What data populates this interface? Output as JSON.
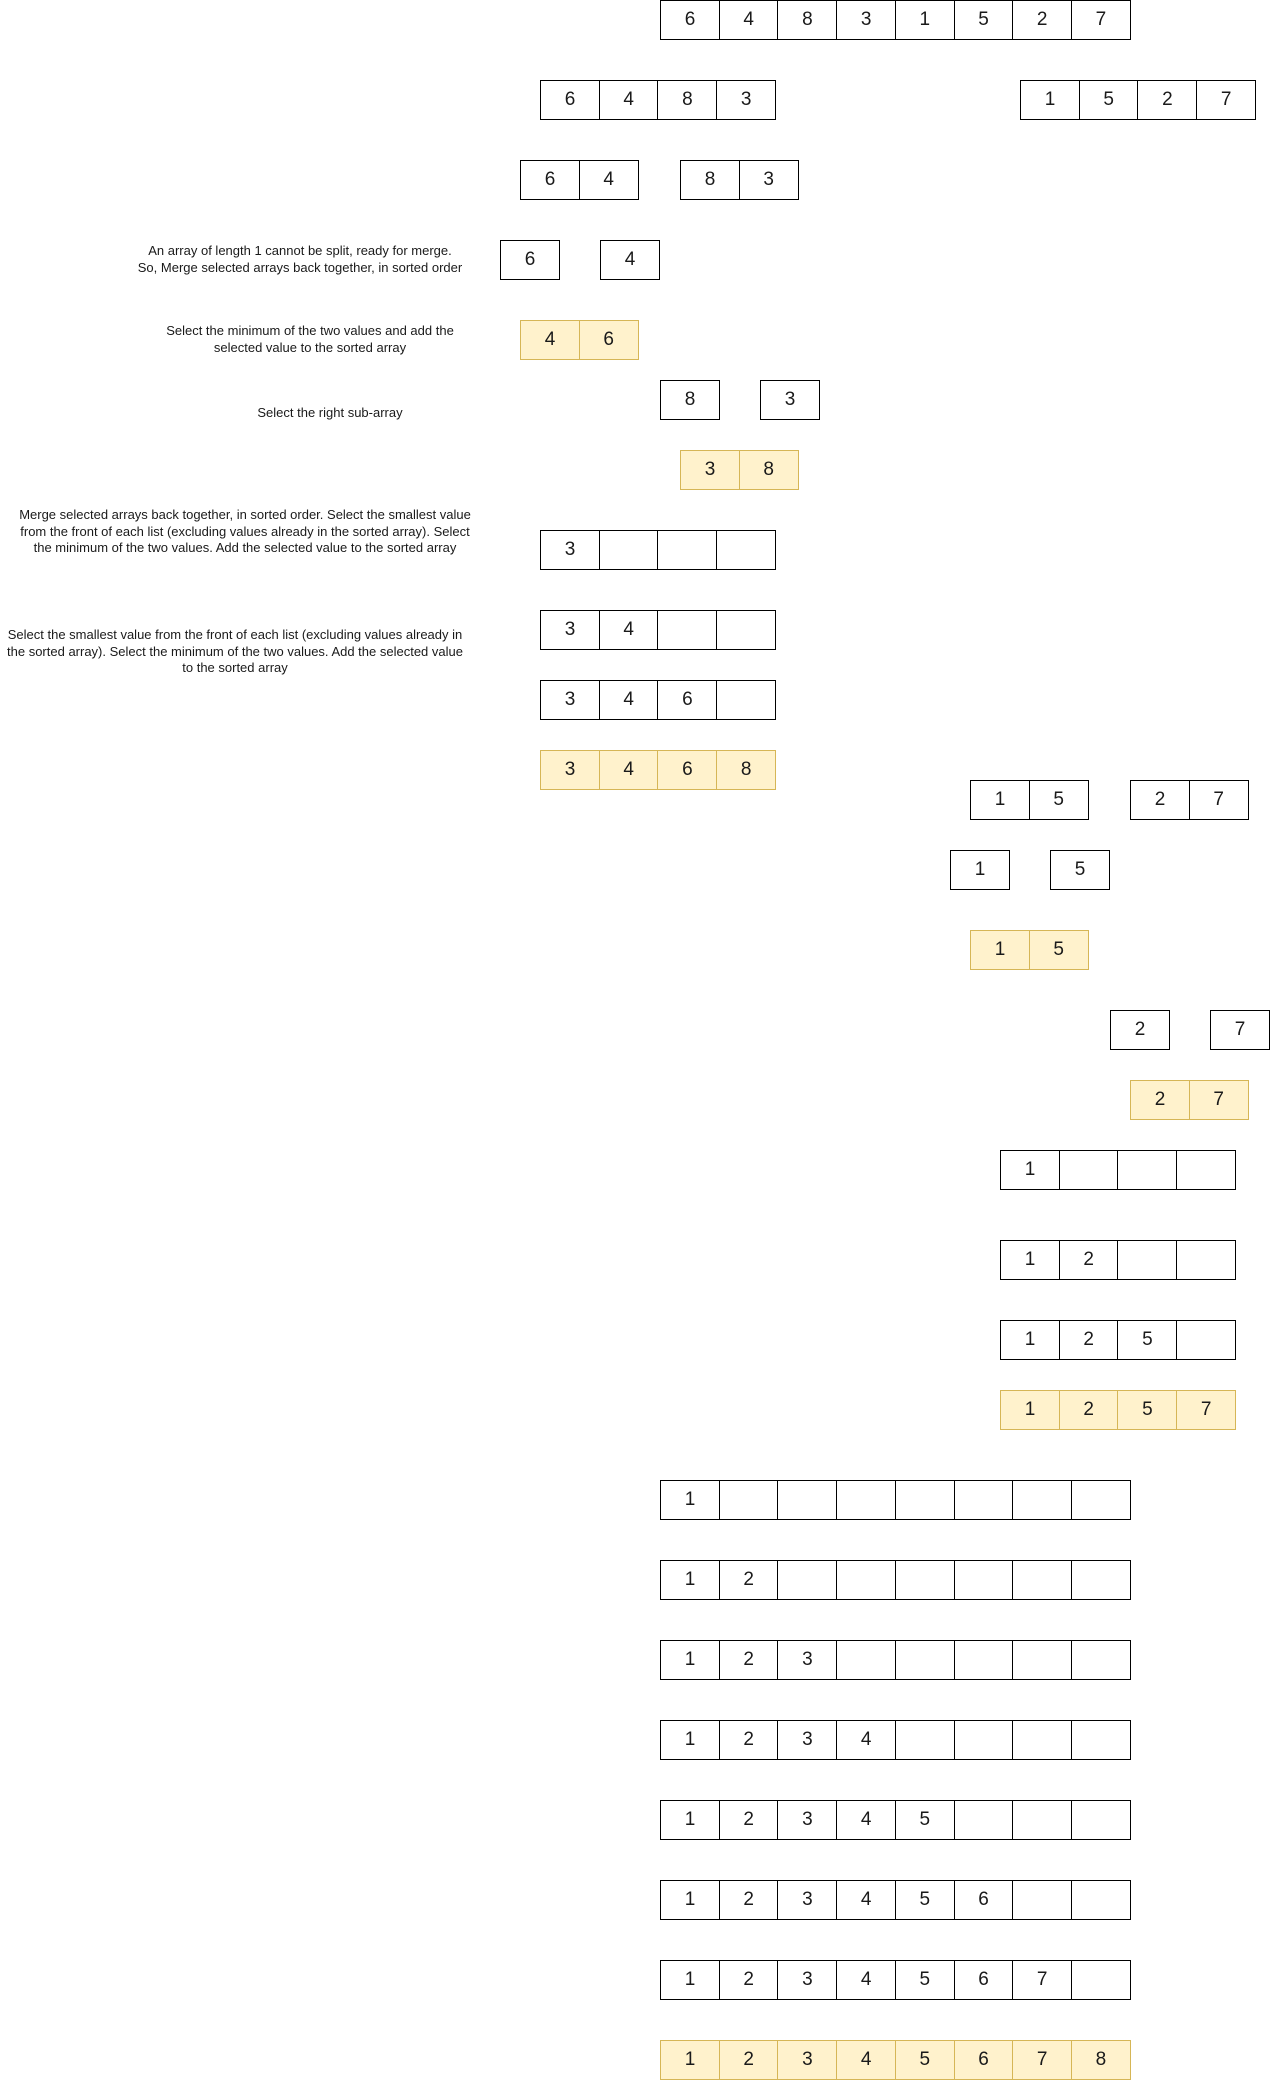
{
  "arrays": [
    {
      "id": "a01",
      "cells": [
        "6",
        "4",
        "8",
        "3",
        "1",
        "5",
        "2",
        "7"
      ],
      "highlight": false
    },
    {
      "id": "a02",
      "cells": [
        "6",
        "4",
        "8",
        "3"
      ],
      "highlight": false
    },
    {
      "id": "a03",
      "cells": [
        "1",
        "5",
        "2",
        "7"
      ],
      "highlight": false
    },
    {
      "id": "a04",
      "cells": [
        "6",
        "4"
      ],
      "highlight": false
    },
    {
      "id": "a05",
      "cells": [
        "8",
        "3"
      ],
      "highlight": false
    },
    {
      "id": "a06",
      "cells": [
        "6"
      ],
      "highlight": false
    },
    {
      "id": "a07",
      "cells": [
        "4"
      ],
      "highlight": false
    },
    {
      "id": "a08",
      "cells": [
        "4",
        "6"
      ],
      "highlight": true
    },
    {
      "id": "a09",
      "cells": [
        "8"
      ],
      "highlight": false
    },
    {
      "id": "a10",
      "cells": [
        "3"
      ],
      "highlight": false
    },
    {
      "id": "a11",
      "cells": [
        "3",
        "8"
      ],
      "highlight": true
    },
    {
      "id": "a12",
      "cells": [
        "3",
        "",
        "",
        ""
      ],
      "highlight": false
    },
    {
      "id": "a13",
      "cells": [
        "3",
        "4",
        "",
        ""
      ],
      "highlight": false
    },
    {
      "id": "a14",
      "cells": [
        "3",
        "4",
        "6",
        ""
      ],
      "highlight": false
    },
    {
      "id": "a15",
      "cells": [
        "3",
        "4",
        "6",
        "8"
      ],
      "highlight": true
    },
    {
      "id": "a16",
      "cells": [
        "1",
        "5"
      ],
      "highlight": false
    },
    {
      "id": "a17",
      "cells": [
        "2",
        "7"
      ],
      "highlight": false
    },
    {
      "id": "a18",
      "cells": [
        "1"
      ],
      "highlight": false
    },
    {
      "id": "a19",
      "cells": [
        "5"
      ],
      "highlight": false
    },
    {
      "id": "a20",
      "cells": [
        "1",
        "5"
      ],
      "highlight": true
    },
    {
      "id": "a21",
      "cells": [
        "2"
      ],
      "highlight": false
    },
    {
      "id": "a22",
      "cells": [
        "7"
      ],
      "highlight": false
    },
    {
      "id": "a23",
      "cells": [
        "2",
        "7"
      ],
      "highlight": true
    },
    {
      "id": "a24",
      "cells": [
        "1",
        "",
        "",
        ""
      ],
      "highlight": false
    },
    {
      "id": "a25",
      "cells": [
        "1",
        "2",
        "",
        ""
      ],
      "highlight": false
    },
    {
      "id": "a26",
      "cells": [
        "1",
        "2",
        "5",
        ""
      ],
      "highlight": false
    },
    {
      "id": "a27",
      "cells": [
        "1",
        "2",
        "5",
        "7"
      ],
      "highlight": true
    },
    {
      "id": "a28",
      "cells": [
        "1",
        "",
        "",
        "",
        "",
        "",
        "",
        ""
      ],
      "highlight": false
    },
    {
      "id": "a29",
      "cells": [
        "1",
        "2",
        "",
        "",
        "",
        "",
        "",
        ""
      ],
      "highlight": false
    },
    {
      "id": "a30",
      "cells": [
        "1",
        "2",
        "3",
        "",
        "",
        "",
        "",
        ""
      ],
      "highlight": false
    },
    {
      "id": "a31",
      "cells": [
        "1",
        "2",
        "3",
        "4",
        "",
        "",
        "",
        ""
      ],
      "highlight": false
    },
    {
      "id": "a32",
      "cells": [
        "1",
        "2",
        "3",
        "4",
        "5",
        "",
        "",
        ""
      ],
      "highlight": false
    },
    {
      "id": "a33",
      "cells": [
        "1",
        "2",
        "3",
        "4",
        "5",
        "6",
        "",
        ""
      ],
      "highlight": false
    },
    {
      "id": "a34",
      "cells": [
        "1",
        "2",
        "3",
        "4",
        "5",
        "6",
        "7",
        ""
      ],
      "highlight": false
    },
    {
      "id": "a35",
      "cells": [
        "1",
        "2",
        "3",
        "4",
        "5",
        "6",
        "7",
        "8"
      ],
      "highlight": true
    }
  ],
  "notes": {
    "split_ready": "An array of length 1 cannot be split, ready for merge.\nSo, Merge selected arrays back together, in sorted order",
    "select_minimum": "Select the minimum of the two values and add the selected value to the sorted array",
    "right_subarray": "Select the right sub-array",
    "merge_sorted": "Merge selected arrays back together, in sorted order. Select the smallest value from the front of each list (excluding values already in the sorted array). Select the minimum of the two values. Add the selected value to the sorted array",
    "select_smallest": "Select the smallest value from the front of each list (excluding values already in the sorted array). Select the minimum of the two values. Add the selected value to the sorted array"
  },
  "colors": {
    "highlight_fill": "#fff2cc",
    "highlight_border": "#d6b656",
    "cell_border": "#000000",
    "text": "#1a1a1a"
  }
}
